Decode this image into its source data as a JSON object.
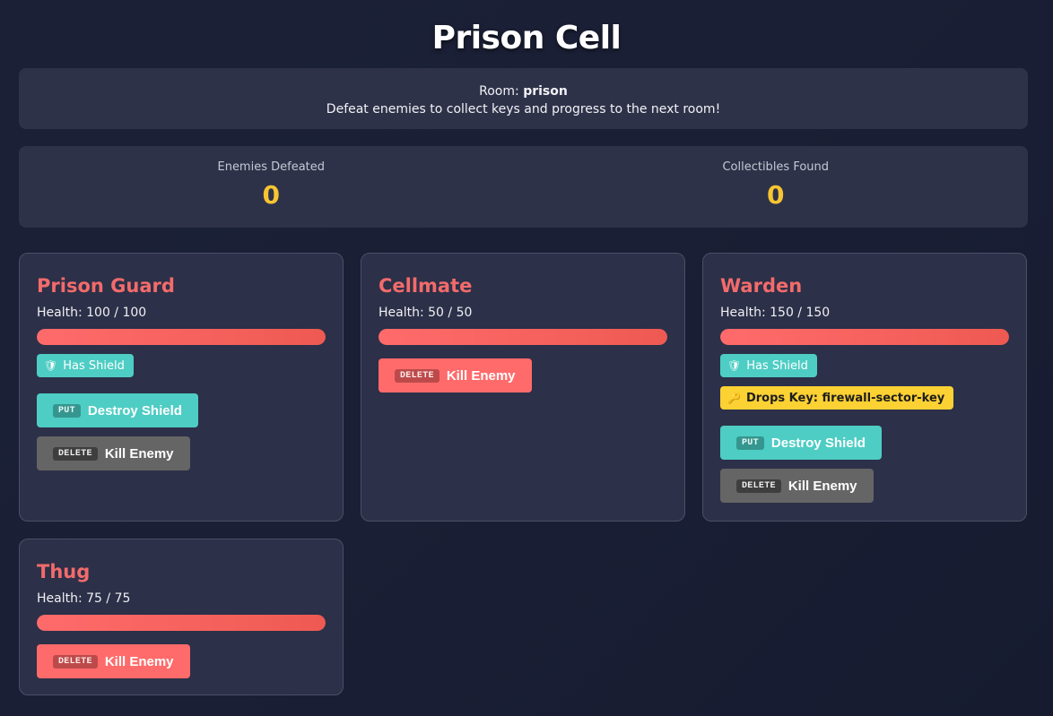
{
  "page": {
    "title": "Prison Cell"
  },
  "room": {
    "label": "Room:",
    "name": "prison",
    "description": "Defeat enemies to collect keys and progress to the next room!"
  },
  "stats": {
    "enemies_label": "Enemies Defeated",
    "enemies_value": "0",
    "collectibles_label": "Collectibles Found",
    "collectibles_value": "0"
  },
  "enemies": [
    {
      "name": "Prison Guard",
      "health_text": "Health: 100 / 100",
      "health_fraction": 1.0,
      "shield_badge": "Has Shield",
      "put_method": "PUT",
      "put_label": "Destroy Shield",
      "delete_method": "DELETE",
      "delete_label": "Kill Enemy"
    },
    {
      "name": "Cellmate",
      "health_text": "Health: 50 / 50",
      "health_fraction": 1.0,
      "delete_method": "DELETE",
      "delete_label": "Kill Enemy"
    },
    {
      "name": "Warden",
      "health_text": "Health: 150 / 150",
      "health_fraction": 1.0,
      "shield_badge": "Has Shield",
      "key_badge": "Drops Key: firewall-sector-key",
      "put_method": "PUT",
      "put_label": "Destroy Shield",
      "delete_method": "DELETE",
      "delete_label": "Kill Enemy"
    },
    {
      "name": "Thug",
      "health_text": "Health: 75 / 75",
      "health_fraction": 1.0,
      "delete_method": "DELETE",
      "delete_label": "Kill Enemy"
    }
  ],
  "colors": {
    "enemy_name": "#f26b6b",
    "stat_value": "#f7c531",
    "shield": "#4ecdc4",
    "key": "#fcd133",
    "kill_disabled": "#656565",
    "kill_active": "#ff6b6b"
  },
  "icons": {
    "shield": "shield-icon",
    "key": "key-icon"
  }
}
